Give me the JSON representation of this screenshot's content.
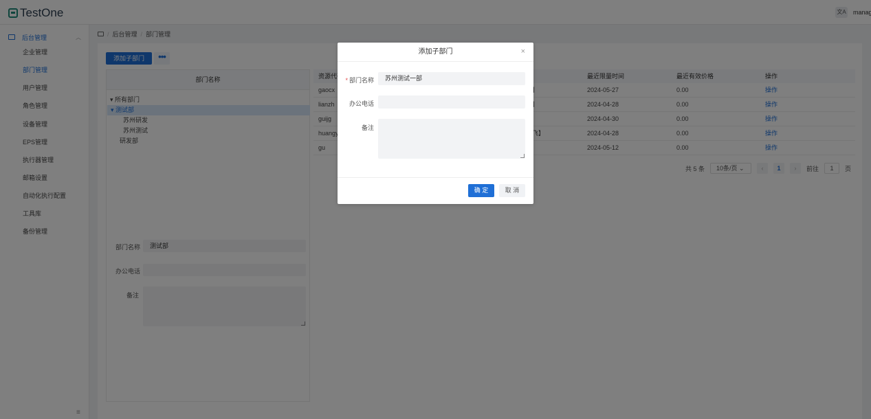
{
  "header": {
    "logo_text": "TestOne",
    "lang_icon": "translate-icon",
    "lang_label": "文A",
    "user_name": "manager"
  },
  "sidebar": {
    "group_label": "后台管理",
    "items": [
      "企业管理",
      "部门管理",
      "用户管理",
      "角色管理",
      "设备管理",
      "EPS管理",
      "执行器管理",
      "邮箱设置",
      "自动化执行配置",
      "工具库",
      "备份管理"
    ],
    "active_index": 1,
    "collapse_icon": "≡"
  },
  "breadcrumb": {
    "root": "后台管理",
    "current": "部门管理",
    "sep": "/"
  },
  "toolbar": {
    "add_sub_dept": "添加子部门",
    "more": "•••"
  },
  "tree": {
    "header": "部门名称",
    "nodes": [
      {
        "label": "▾ 所有部门"
      },
      {
        "label": "▾ 测试部"
      },
      {
        "label": "苏州研发"
      },
      {
        "label": "苏州测试"
      },
      {
        "label": "研发部"
      }
    ]
  },
  "left_form": {
    "name_label": "部门名称",
    "name_value": "测试部",
    "phone_label": "办公电话",
    "phone_value": "",
    "remark_label": "备注"
  },
  "table": {
    "columns": [
      "资源代码",
      "最近限量时间",
      "最近有效价格",
      "操作"
    ],
    "rows": [
      {
        "code": "gaocx",
        "mid": "】",
        "date": "2024-05-27",
        "price": "0.00",
        "op": "操作"
      },
      {
        "code": "lianzh",
        "mid": "】",
        "date": "2024-04-28",
        "price": "0.00",
        "op": "操作"
      },
      {
        "code": "guijg",
        "mid": "",
        "date": "2024-04-30",
        "price": "0.00",
        "op": "操作"
      },
      {
        "code": "huangy",
        "mid": "飞】",
        "date": "2024-04-28",
        "price": "0.00",
        "op": "操作"
      },
      {
        "code": "gu",
        "mid": "",
        "date": "2024-05-12",
        "price": "0.00",
        "op": "操作"
      }
    ]
  },
  "pagination": {
    "total": "共 5 条",
    "page_size": "10条/页",
    "current": "1",
    "goto_label": "前往",
    "goto_value": "1",
    "page_unit": "页"
  },
  "dialog": {
    "title": "添加子部门",
    "close": "×",
    "name_required": "*",
    "name_label": "部门名称",
    "name_value": "苏州测试一部",
    "phone_label": "办公电话",
    "phone_value": "",
    "remark_label": "备注",
    "ok": "确 定",
    "cancel": "取 消"
  }
}
